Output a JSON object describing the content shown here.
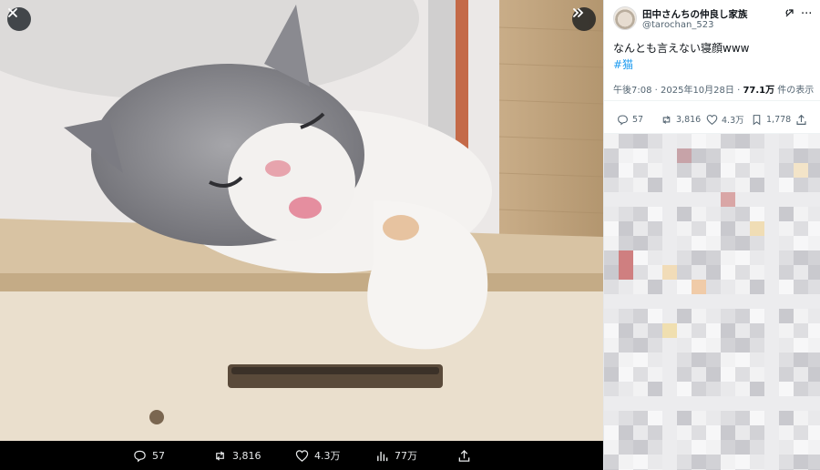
{
  "viewer": {
    "close_icon": "close-icon",
    "expand_icon": "chevron-double-right-icon",
    "actions": {
      "replies": "57",
      "reposts": "3,816",
      "likes": "4.3万",
      "views": "77万"
    }
  },
  "tweet": {
    "display_name": "田中さんちの仲良し家族",
    "handle": "@tarochan_523",
    "text": "なんとも言えない寝顔www",
    "hashtag": "#猫",
    "time": "午後7:08 · 2025年10月28日 · ",
    "views_count": "77.1万",
    "views_suffix": " 件の表示",
    "stats": {
      "replies": "57",
      "reposts": "3,816",
      "likes": "4.3万",
      "bookmarks": "1,778"
    }
  },
  "colors": {
    "link": "#1d9bf0",
    "text": "#0f1419",
    "muted": "#536471"
  }
}
